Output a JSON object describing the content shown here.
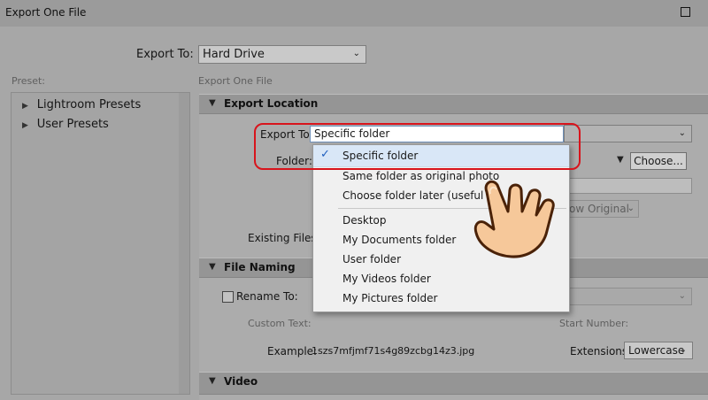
{
  "window": {
    "title": "Export One File"
  },
  "top": {
    "export_to_label": "Export To:",
    "export_to_value": "Hard Drive"
  },
  "preset": {
    "label": "Preset:",
    "items": [
      "Lightroom Presets",
      "User Presets"
    ]
  },
  "breadcrumb": "Export One File",
  "export_location": {
    "header": "Export Location",
    "export_to_label": "Export To:",
    "export_to_value": "Specific folder",
    "folder_label": "Folder:",
    "choose_button": "Choose...",
    "existing_files_label": "Existing Files:",
    "show_original": "ow Original"
  },
  "menu": {
    "items": [
      "Specific folder",
      "Same folder as original photo",
      "Choose folder later (useful fo",
      "Desktop",
      "My Documents folder",
      "User folder",
      "My Videos folder",
      "My Pictures folder"
    ],
    "checkmark": "✓"
  },
  "file_naming": {
    "header": "File Naming",
    "rename_to_label": "Rename To:",
    "custom_text_label": "Custom Text:",
    "start_number_label": "Start Number:",
    "example_label": "Example:",
    "example_value": "1szs7mfjmf71s4g89zcbg14z3.jpg",
    "extensions_label": "Extensions:",
    "extensions_value": "Lowercase"
  },
  "video": {
    "header": "Video"
  },
  "colors": {
    "highlight": "#d8141c",
    "menu_selected": "#d9e7f7",
    "checkmark": "#1f5fbf"
  }
}
